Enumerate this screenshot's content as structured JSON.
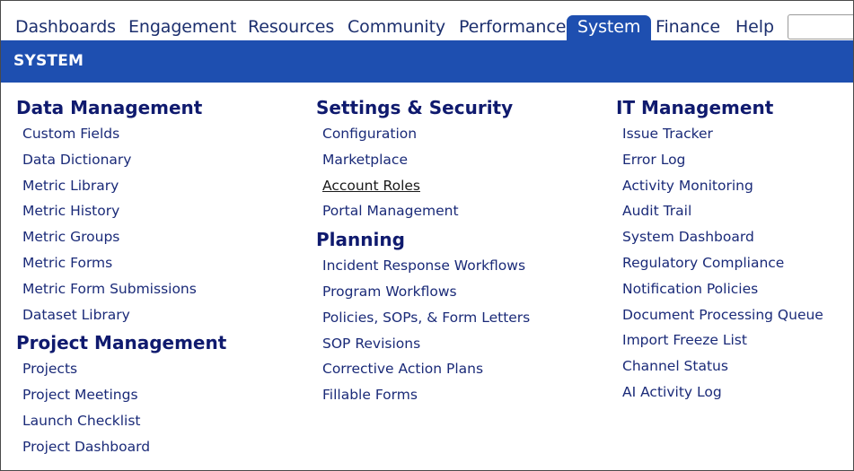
{
  "topnav": {
    "items": [
      {
        "label": "Dashboards",
        "active": false
      },
      {
        "label": "Engagement",
        "active": false
      },
      {
        "label": "Resources",
        "active": false
      },
      {
        "label": "Community",
        "active": false
      },
      {
        "label": "Performance",
        "active": false
      },
      {
        "label": "System",
        "active": true
      },
      {
        "label": "Finance",
        "active": false
      },
      {
        "label": "Help",
        "active": false
      }
    ],
    "search_value": ""
  },
  "banner": {
    "title": "SYSTEM"
  },
  "columns": [
    {
      "sections": [
        {
          "heading": "Data Management",
          "links": [
            "Custom Fields",
            "Data Dictionary",
            "Metric Library",
            "Metric History",
            "Metric Groups",
            "Metric Forms",
            "Metric Form Submissions",
            "Dataset Library"
          ]
        },
        {
          "heading": "Project Management",
          "links": [
            "Projects",
            "Project Meetings",
            "Launch Checklist",
            "Project Dashboard"
          ]
        }
      ]
    },
    {
      "sections": [
        {
          "heading": "Settings & Security",
          "links": [
            "Configuration",
            "Marketplace",
            "Account Roles",
            "Portal Management"
          ]
        },
        {
          "heading": "Planning",
          "links": [
            "Incident Response Workflows",
            "Program Workflows",
            "Policies, SOPs, & Form Letters",
            "SOP Revisions",
            "Corrective Action Plans",
            "Fillable Forms"
          ]
        }
      ]
    },
    {
      "sections": [
        {
          "heading": "IT Management",
          "links": [
            "Issue Tracker",
            "Error Log",
            "Activity Monitoring",
            "Audit Trail",
            "System Dashboard",
            "Regulatory Compliance",
            "Notification Policies",
            "Document Processing Queue",
            "Import Freeze List",
            "Channel Status",
            "AI Activity Log"
          ]
        }
      ]
    }
  ],
  "hovered_link": "Account Roles",
  "colors": {
    "accent": "#1e4fb0",
    "heading": "#0f1a6e",
    "link": "#1a2a78"
  }
}
